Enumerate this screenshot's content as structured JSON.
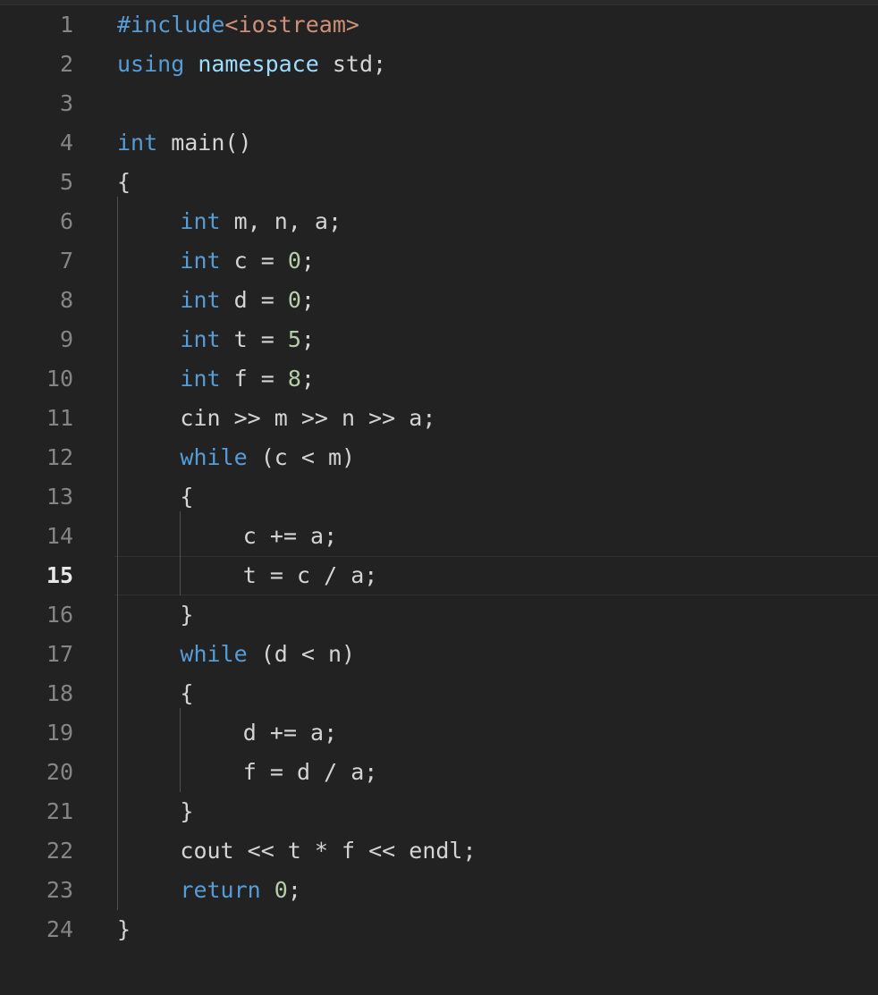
{
  "editor": {
    "language": "C++",
    "theme": "dark-plus",
    "background_color": "#222222",
    "gutter_color": "#858585",
    "active_line_number_color": "#e8e8e8",
    "active_line_border_color": "#303030",
    "indent_guide_color": "#505050",
    "active_line": 15,
    "total_lines": 24,
    "token_colors": {
      "keyword": "#569cd6",
      "namespace": "#9cdcfe",
      "string": "#ce9178",
      "number": "#b5cea8",
      "plain": "#d4d4d4"
    },
    "lines": [
      {
        "n": "1",
        "indent": 0,
        "tokens": [
          {
            "t": "#include",
            "c": "kw"
          },
          {
            "t": "<iostream>",
            "c": "str"
          }
        ]
      },
      {
        "n": "2",
        "indent": 0,
        "tokens": [
          {
            "t": "using",
            "c": "kw"
          },
          {
            "t": " ",
            "c": "pln"
          },
          {
            "t": "namespace",
            "c": "kw2"
          },
          {
            "t": " std;",
            "c": "pln"
          }
        ]
      },
      {
        "n": "3",
        "indent": 0,
        "tokens": []
      },
      {
        "n": "4",
        "indent": 0,
        "tokens": [
          {
            "t": "int",
            "c": "kw"
          },
          {
            "t": " main()",
            "c": "pln"
          }
        ]
      },
      {
        "n": "5",
        "indent": 0,
        "tokens": [
          {
            "t": "{",
            "c": "pln"
          }
        ]
      },
      {
        "n": "6",
        "indent": 1,
        "tokens": [
          {
            "t": "int",
            "c": "kw"
          },
          {
            "t": " m, n, a;",
            "c": "pln"
          }
        ]
      },
      {
        "n": "7",
        "indent": 1,
        "tokens": [
          {
            "t": "int",
            "c": "kw"
          },
          {
            "t": " c = ",
            "c": "pln"
          },
          {
            "t": "0",
            "c": "num"
          },
          {
            "t": ";",
            "c": "pln"
          }
        ]
      },
      {
        "n": "8",
        "indent": 1,
        "tokens": [
          {
            "t": "int",
            "c": "kw"
          },
          {
            "t": " d = ",
            "c": "pln"
          },
          {
            "t": "0",
            "c": "num"
          },
          {
            "t": ";",
            "c": "pln"
          }
        ]
      },
      {
        "n": "9",
        "indent": 1,
        "tokens": [
          {
            "t": "int",
            "c": "kw"
          },
          {
            "t": " t = ",
            "c": "pln"
          },
          {
            "t": "5",
            "c": "num"
          },
          {
            "t": ";",
            "c": "pln"
          }
        ]
      },
      {
        "n": "10",
        "indent": 1,
        "tokens": [
          {
            "t": "int",
            "c": "kw"
          },
          {
            "t": " f = ",
            "c": "pln"
          },
          {
            "t": "8",
            "c": "num"
          },
          {
            "t": ";",
            "c": "pln"
          }
        ]
      },
      {
        "n": "11",
        "indent": 1,
        "tokens": [
          {
            "t": "cin >> m >> n >> a;",
            "c": "pln"
          }
        ]
      },
      {
        "n": "12",
        "indent": 1,
        "tokens": [
          {
            "t": "while",
            "c": "kw"
          },
          {
            "t": " (c < m)",
            "c": "pln"
          }
        ]
      },
      {
        "n": "13",
        "indent": 1,
        "tokens": [
          {
            "t": "{",
            "c": "pln"
          }
        ]
      },
      {
        "n": "14",
        "indent": 2,
        "tokens": [
          {
            "t": "c += a;",
            "c": "pln"
          }
        ]
      },
      {
        "n": "15",
        "indent": 2,
        "tokens": [
          {
            "t": "t = c / a;",
            "c": "pln"
          }
        ]
      },
      {
        "n": "16",
        "indent": 1,
        "tokens": [
          {
            "t": "}",
            "c": "pln"
          }
        ]
      },
      {
        "n": "17",
        "indent": 1,
        "tokens": [
          {
            "t": "while",
            "c": "kw"
          },
          {
            "t": " (d < n)",
            "c": "pln"
          }
        ]
      },
      {
        "n": "18",
        "indent": 1,
        "tokens": [
          {
            "t": "{",
            "c": "pln"
          }
        ]
      },
      {
        "n": "19",
        "indent": 2,
        "tokens": [
          {
            "t": "d += a;",
            "c": "pln"
          }
        ]
      },
      {
        "n": "20",
        "indent": 2,
        "tokens": [
          {
            "t": "f = d / a;",
            "c": "pln"
          }
        ]
      },
      {
        "n": "21",
        "indent": 1,
        "tokens": [
          {
            "t": "}",
            "c": "pln"
          }
        ]
      },
      {
        "n": "22",
        "indent": 1,
        "tokens": [
          {
            "t": "cout << t * f << endl;",
            "c": "pln"
          }
        ]
      },
      {
        "n": "23",
        "indent": 1,
        "tokens": [
          {
            "t": "return",
            "c": "kw"
          },
          {
            "t": " ",
            "c": "pln"
          },
          {
            "t": "0",
            "c": "num"
          },
          {
            "t": ";",
            "c": "pln"
          }
        ]
      },
      {
        "n": "24",
        "indent": 0,
        "tokens": [
          {
            "t": "}",
            "c": "pln"
          }
        ]
      }
    ],
    "indent_guides": [
      {
        "level": 1,
        "from_line": 6,
        "to_line": 23
      },
      {
        "level": 2,
        "from_line": 14,
        "to_line": 15
      },
      {
        "level": 2,
        "from_line": 19,
        "to_line": 20
      }
    ]
  }
}
